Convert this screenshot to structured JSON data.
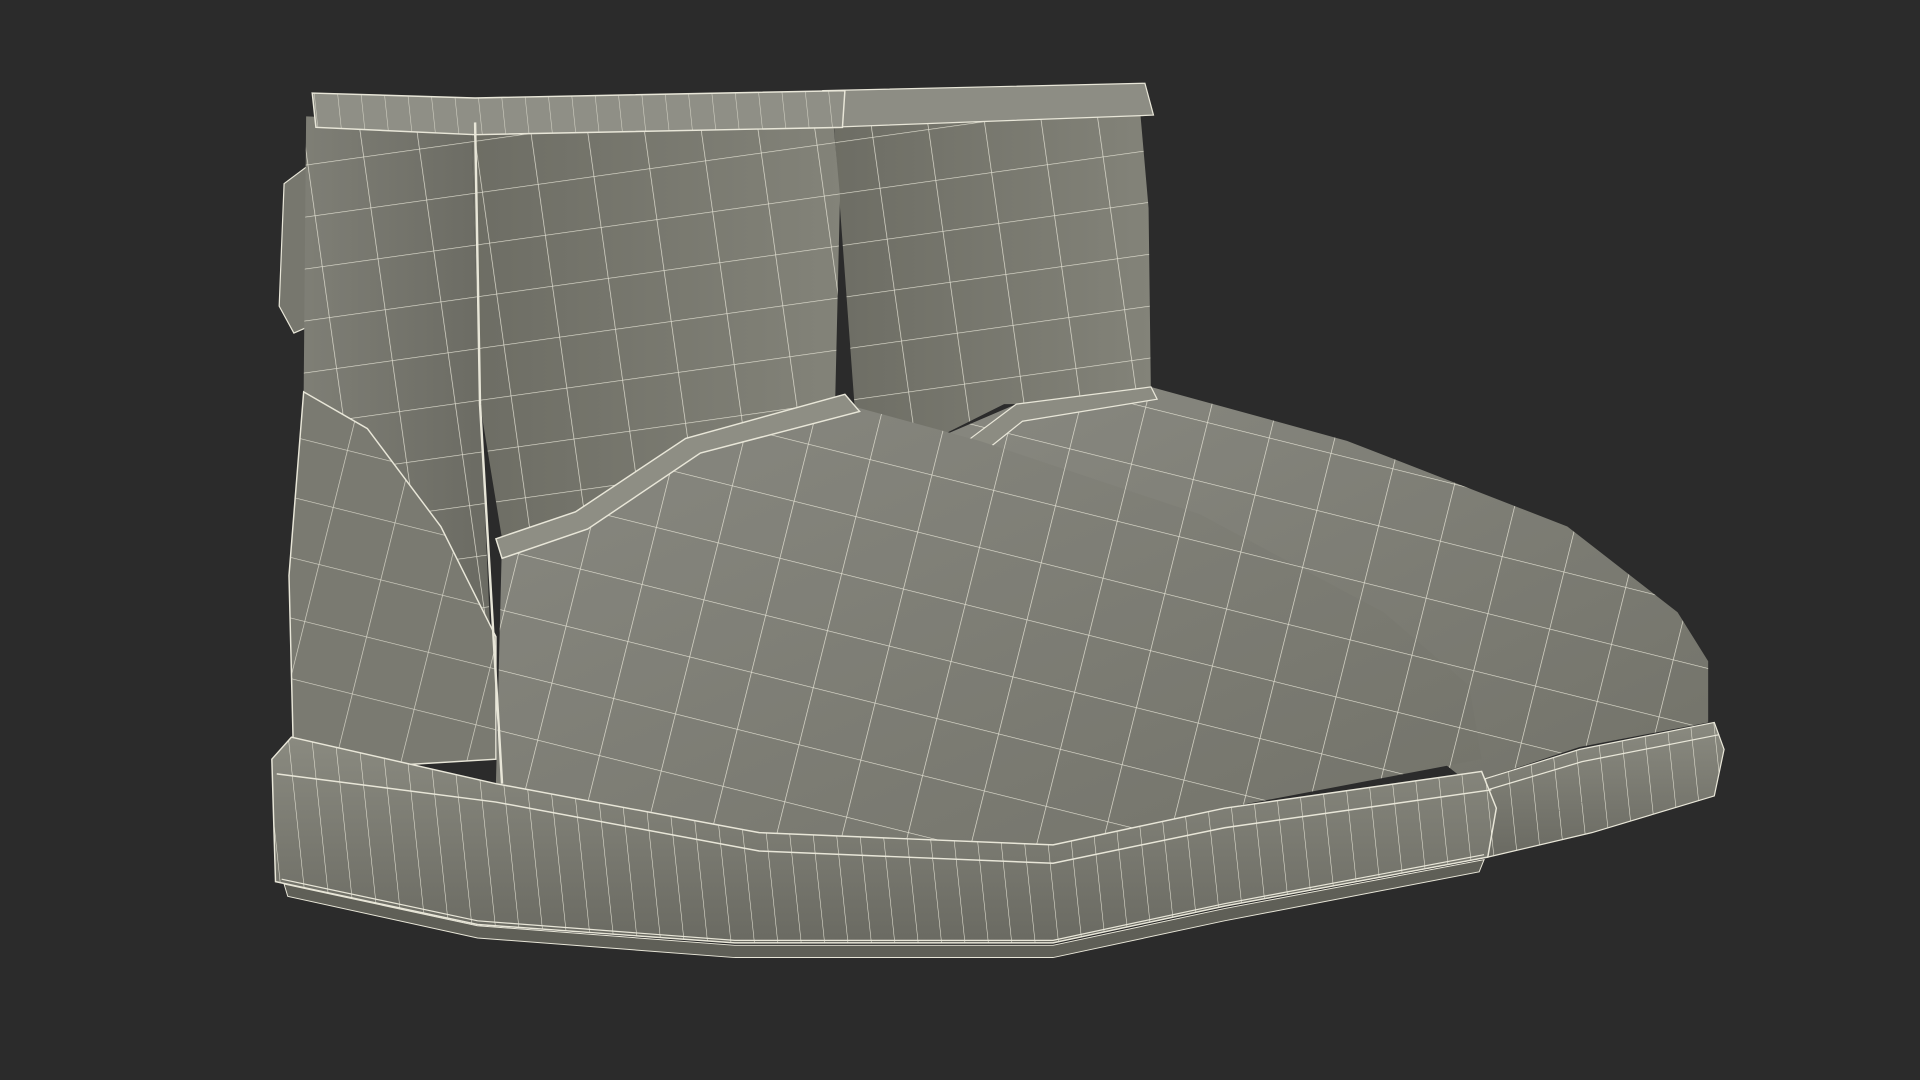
{
  "scene": {
    "subject": "boots-wireframe-pair",
    "colors": {
      "background": "#2b2b2b",
      "surface": "#7b7b71",
      "surface_dark": "#5c5c54",
      "surface_light": "#8c8c82",
      "wire": "#e8e6d8"
    }
  }
}
